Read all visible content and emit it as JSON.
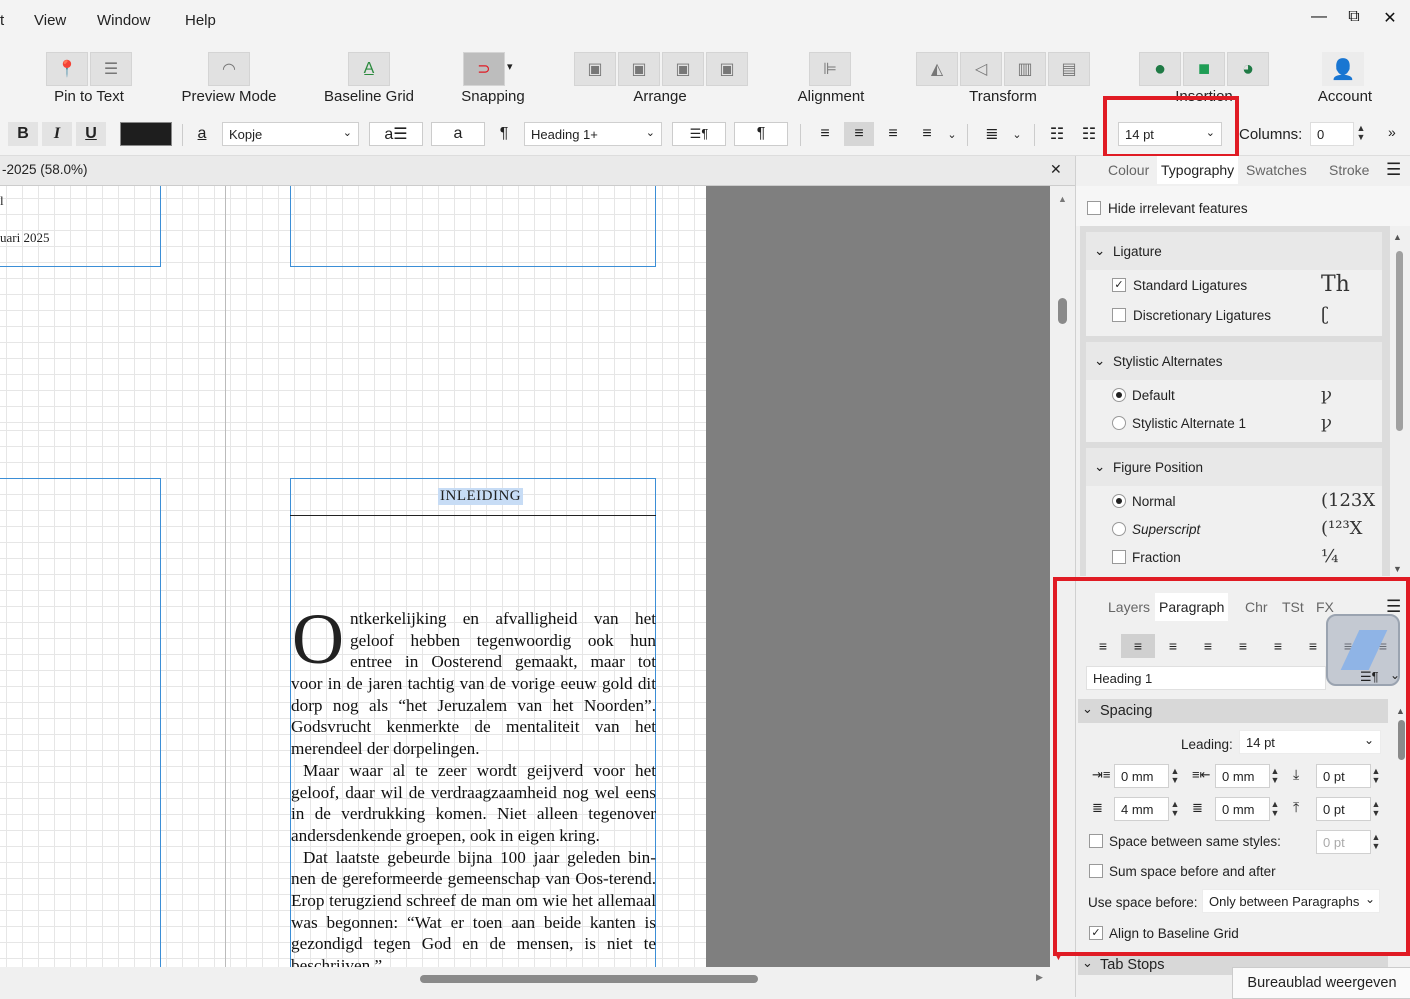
{
  "menu": {
    "items": [
      "View",
      "Window",
      "Help"
    ]
  },
  "window": {
    "minimize": "—",
    "restore": "⧉",
    "close": "✕"
  },
  "toolbar": {
    "pin_to_text": "Pin to Text",
    "preview_mode": "Preview Mode",
    "baseline_grid": "Baseline Grid",
    "snapping": "Snapping",
    "arrange": "Arrange",
    "alignment": "Alignment",
    "transform": "Transform",
    "insertion": "Insertion",
    "account": "Account"
  },
  "formatbar": {
    "bold": "B",
    "italic": "I",
    "underline": "U",
    "char_style": "Kopje",
    "para_style": "Heading 1+",
    "font_size": "14 pt",
    "columns_label": "Columns:",
    "columns_value": "0",
    "overflow": "»"
  },
  "document": {
    "tab_title": "-2025 (58.0%)",
    "close": "✕",
    "top_page_line1": "l",
    "top_page_line2": "uari 2025",
    "heading": "INLEIDING",
    "dropcap": "O",
    "para1_lines": [
      "ntkerkelijking en afvalligheid van het",
      "geloof hebben tegenwoordig ook hun",
      "entree in Oosterend gemaakt, maar tot"
    ],
    "para1_rest": "voor in de jaren tachtig van de vorige eeuw gold dit dorp nog als “het Jeruzalem van het Noorden”. Godsvrucht kenmerkte de mentaliteit van het merendeel der dorpelingen.",
    "para2": "Maar waar al te zeer wordt geijverd voor het geloof, daar wil de verdraagzaamheid nog wel eens in de verdrukking komen. Niet alleen tegenover andersdenkende groepen, ook in eigen kring.",
    "para3": "Dat laatste gebeurde bijna 100 jaar geleden bin-nen de gereformeerde gemeenschap van Oos-terend. Erop terugziend schreef de man om wie het allemaal was begonnen: “Wat er toen aan beide kanten is gezondigd tegen God en de mensen, is niet te beschrijven.”"
  },
  "typography_panel": {
    "tabs": [
      "Colour",
      "Typography",
      "Swatches",
      "Stroke"
    ],
    "active_tab": "Typography",
    "hide_irrelevant": "Hide irrelevant features",
    "ligature": {
      "title": "Ligature",
      "standard": "Standard Ligatures",
      "standard_glyph": "Th",
      "discretionary": "Discretionary Ligatures",
      "discretionary_glyph": "ʗ"
    },
    "stylistic": {
      "title": "Stylistic Alternates",
      "default": "Default",
      "default_glyph": "ꝩ",
      "alt1": "Stylistic Alternate 1",
      "alt1_glyph": "ꝩ"
    },
    "figure": {
      "title": "Figure Position",
      "normal": "Normal",
      "normal_glyph": "(123X",
      "superscript": "Superscript",
      "superscript_glyph": "(¹²³X",
      "fraction": "Fraction",
      "fraction_glyph": "¼"
    }
  },
  "paragraph_panel": {
    "tabs": [
      "Layers",
      "Paragraph",
      "Chr",
      "TSt",
      "FX"
    ],
    "active_tab": "Paragraph",
    "style": "Heading 1",
    "spacing_title": "Spacing",
    "leading_label": "Leading:",
    "leading_value": "14 pt",
    "indent_left": "0 mm",
    "indent_right": "0 mm",
    "space_before": "0 pt",
    "first_line": "4 mm",
    "last_line": "0 mm",
    "space_after": "0 pt",
    "same_styles_label": "Space between same styles:",
    "same_styles_value": "0 pt",
    "sum_space": "Sum space before and after",
    "use_space_label": "Use space before:",
    "use_space_value": "Only between Paragraphs",
    "align_baseline": "Align to Baseline Grid",
    "tab_stops": "Tab Stops"
  },
  "tooltip": "Bureaublad weergeven",
  "colors": {
    "highlight": "#e01b24",
    "frame": "#3b8ed6",
    "active_green": "#1f9d55"
  }
}
